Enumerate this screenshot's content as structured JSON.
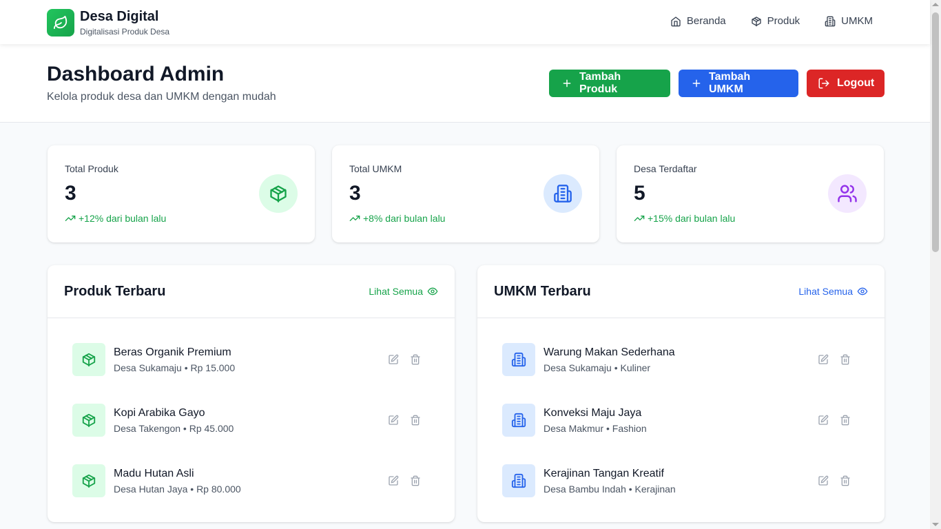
{
  "brand": {
    "title": "Desa Digital",
    "subtitle": "Digitalisasi Produk Desa",
    "icon": "leaf-icon"
  },
  "nav": [
    {
      "label": "Beranda",
      "icon": "home-icon"
    },
    {
      "label": "Produk",
      "icon": "package-icon"
    },
    {
      "label": "UMKM",
      "icon": "building-icon"
    }
  ],
  "header": {
    "title": "Dashboard Admin",
    "subtitle": "Kelola produk desa dan UMKM dengan mudah",
    "buttons": {
      "add_product": "Tambah Produk",
      "add_umkm": "Tambah UMKM",
      "logout": "Logout"
    }
  },
  "stats": [
    {
      "label": "Total Produk",
      "value": "3",
      "trend": "+12% dari bulan lalu",
      "icon": "package-icon"
    },
    {
      "label": "Total UMKM",
      "value": "3",
      "trend": "+8% dari bulan lalu",
      "icon": "building-icon"
    },
    {
      "label": "Desa Terdaftar",
      "value": "5",
      "trend": "+15% dari bulan lalu",
      "icon": "users-icon"
    }
  ],
  "products": {
    "title": "Produk Terbaru",
    "view_all": "Lihat Semua",
    "items": [
      {
        "name": "Beras Organik Premium",
        "meta": "Desa Sukamaju • Rp 15.000"
      },
      {
        "name": "Kopi Arabika Gayo",
        "meta": "Desa Takengon • Rp 45.000"
      },
      {
        "name": "Madu Hutan Asli",
        "meta": "Desa Hutan Jaya • Rp 80.000"
      }
    ]
  },
  "umkm": {
    "title": "UMKM Terbaru",
    "view_all": "Lihat Semua",
    "items": [
      {
        "name": "Warung Makan Sederhana",
        "meta": "Desa Sukamaju • Kuliner"
      },
      {
        "name": "Konveksi Maju Jaya",
        "meta": "Desa Makmur • Fashion"
      },
      {
        "name": "Kerajinan Tangan Kreatif",
        "meta": "Desa Bambu Indah • Kerajinan"
      }
    ]
  },
  "colors": {
    "green": "#16a34a",
    "blue": "#2563eb",
    "red": "#dc2626",
    "purple": "#9333ea",
    "green_bg": "#dcfce7",
    "blue_bg": "#dbeafe",
    "purple_bg": "#f3e8ff"
  }
}
